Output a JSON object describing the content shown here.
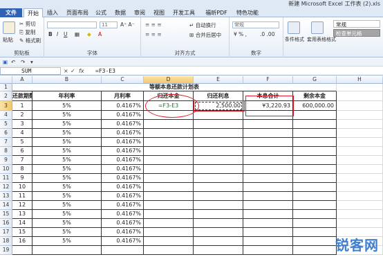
{
  "window": {
    "title": "新建 Microsoft Excel 工作表 (2).xls"
  },
  "tabs": [
    "文件",
    "开始",
    "插入",
    "页面布局",
    "公式",
    "数据",
    "审阅",
    "视图",
    "开发工具",
    "福昕PDF",
    "特色功能"
  ],
  "ribbon": {
    "clipboard": {
      "paste": "粘贴",
      "cut": "剪切",
      "copy": "复制",
      "format_painter": "格式刷",
      "label": "剪贴板"
    },
    "font": {
      "size": "11",
      "label": "字体"
    },
    "alignment": {
      "wrap": "自动换行",
      "merge": "合并后居中",
      "label": "对齐方式"
    },
    "number": {
      "format": "常规",
      "label": "数字"
    },
    "styles": {
      "conditional": "条件格式",
      "table": "套用表格格式",
      "normal": "常规",
      "check": "检查单元格"
    }
  },
  "formula_bar": {
    "name_box": "SUM",
    "cancel": "×",
    "enter": "✓",
    "fx": "fx",
    "formula": "=F3-E3"
  },
  "columns": [
    "A",
    "B",
    "C",
    "D",
    "E",
    "F",
    "G",
    "H"
  ],
  "sheet": {
    "title": "等额本息还款计划表",
    "headers": [
      "还款期数",
      "年利率",
      "月利率",
      "归还本金",
      "归还利息",
      "本息合计",
      "剩余本金"
    ],
    "editing_cell": "=F3-E3",
    "row3": {
      "interest": "2,500.00",
      "total": "¥3,220.93",
      "remaining": "600,000.00"
    },
    "rows": [
      {
        "n": "1",
        "annual": "5%",
        "monthly": "0.4167%"
      },
      {
        "n": "2",
        "annual": "5%",
        "monthly": "0.4167%"
      },
      {
        "n": "3",
        "annual": "5%",
        "monthly": "0.4167%"
      },
      {
        "n": "4",
        "annual": "5%",
        "monthly": "0.4167%"
      },
      {
        "n": "5",
        "annual": "5%",
        "monthly": "0.4167%"
      },
      {
        "n": "6",
        "annual": "5%",
        "monthly": "0.4167%"
      },
      {
        "n": "7",
        "annual": "5%",
        "monthly": "0.4167%"
      },
      {
        "n": "8",
        "annual": "5%",
        "monthly": "0.4167%"
      },
      {
        "n": "9",
        "annual": "5%",
        "monthly": "0.4167%"
      },
      {
        "n": "10",
        "annual": "5%",
        "monthly": "0.4167%"
      },
      {
        "n": "11",
        "annual": "5%",
        "monthly": "0.4167%"
      },
      {
        "n": "12",
        "annual": "5%",
        "monthly": "0.4167%"
      },
      {
        "n": "13",
        "annual": "5%",
        "monthly": "0.4167%"
      },
      {
        "n": "14",
        "annual": "5%",
        "monthly": "0.4167%"
      },
      {
        "n": "15",
        "annual": "5%",
        "monthly": "0.4167%"
      },
      {
        "n": "16",
        "annual": "5%",
        "monthly": "0.4167%"
      }
    ],
    "row_numbers": [
      "1",
      "2",
      "3",
      "4",
      "5",
      "6",
      "7",
      "8",
      "9",
      "10",
      "11",
      "12",
      "13",
      "14",
      "15",
      "16",
      "17",
      "18",
      "19"
    ]
  },
  "watermark": {
    "text_a": "锐客",
    "text_b": "网"
  },
  "colors": {
    "file_tab": "#2f62b3",
    "annotation": "#e0202a",
    "selected_header": "#f5c86a"
  }
}
